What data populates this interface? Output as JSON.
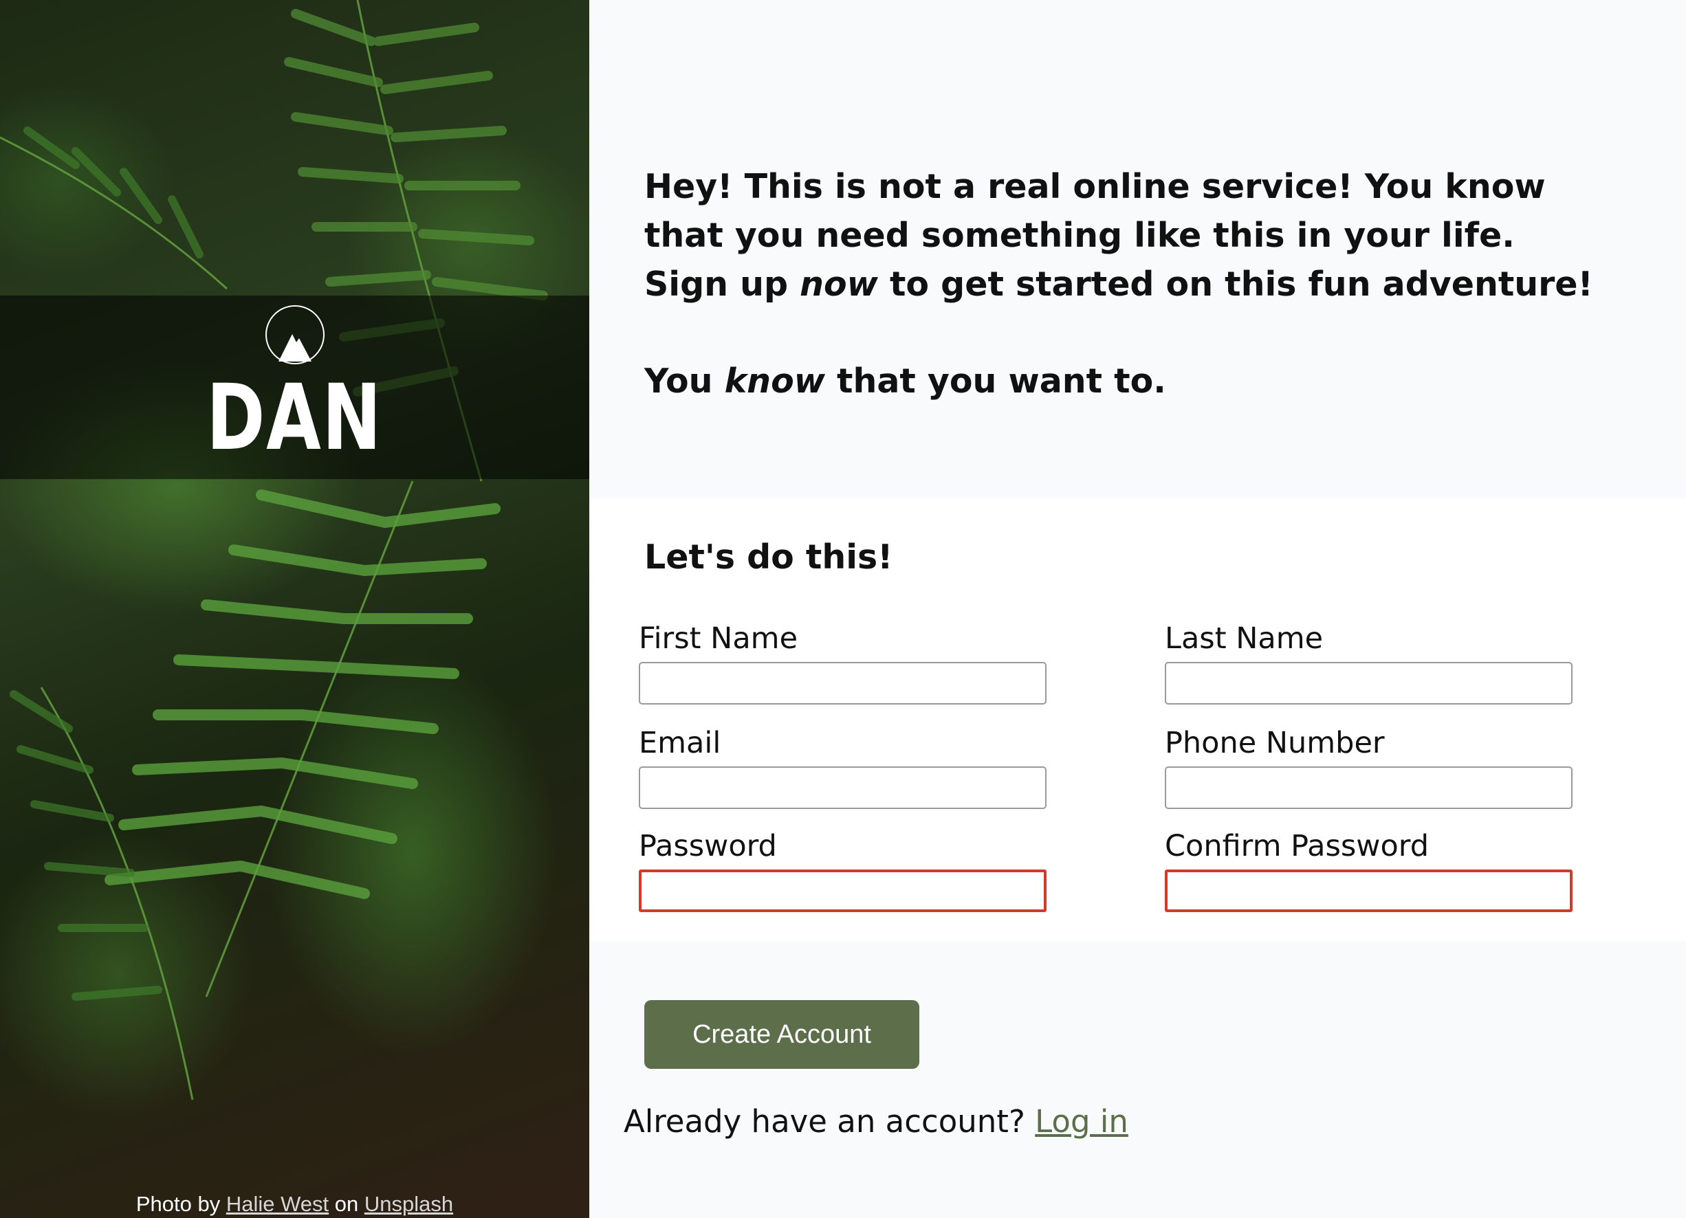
{
  "hero": {
    "logo_text": "DAN",
    "credit_prefix": "Photo by",
    "credit_author": "Halie West",
    "credit_mid": "on",
    "credit_site": "Unsplash"
  },
  "intro": {
    "line1_part1": "Hey! This is not a real online service! You know that you need something like this in your life. Sign up ",
    "line1_emphasis": "now",
    "line1_part2": " to get started on this fun adventure!",
    "line2_part1": "You ",
    "line2_emphasis": "know",
    "line2_part2": " that you want to."
  },
  "form": {
    "title": "Let's do this!",
    "fields": [
      {
        "label": "First Name",
        "value": ""
      },
      {
        "label": "Last Name",
        "value": ""
      },
      {
        "label": "Email",
        "value": ""
      },
      {
        "label": "Phone Number",
        "value": ""
      },
      {
        "label": "Password",
        "value": ""
      },
      {
        "label": "Confirm Password",
        "value": ""
      }
    ],
    "submit_label": "Create Account",
    "login_prompt": "Already have an account?",
    "login_link": "Log in"
  },
  "colors": {
    "accent": "#5c6f4a",
    "invalid_border": "#d23a2a",
    "panel_bg": "#f9fafb",
    "form_bg": "#ffffff"
  },
  "icons": {
    "logo_mark": "mountain-icon"
  }
}
